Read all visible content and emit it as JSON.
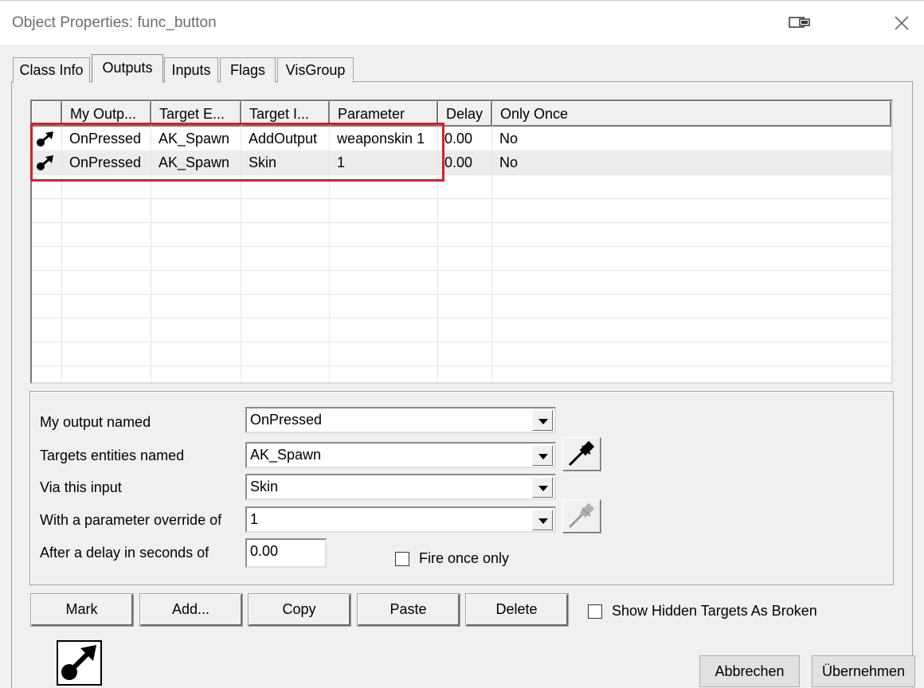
{
  "window": {
    "title": "Object Properties: func_button",
    "restore_icon": "restore-window-icon",
    "close_icon": "close-icon"
  },
  "tabs": [
    {
      "label": "Class Info",
      "active": false
    },
    {
      "label": "Outputs",
      "active": true
    },
    {
      "label": "Inputs",
      "active": false
    },
    {
      "label": "Flags",
      "active": false
    },
    {
      "label": "VisGroup",
      "active": false
    }
  ],
  "outputs_table": {
    "columns": [
      "",
      "My Outp...",
      "Target E...",
      "Target I...",
      "Parameter",
      "Delay",
      "Only Once"
    ],
    "rows": [
      {
        "icon": "output-connection-icon",
        "my_output": "OnPressed",
        "target_entity": "AK_Spawn",
        "target_input": "AddOutput",
        "parameter": "weaponskin 1",
        "delay": "0.00",
        "only_once": "No"
      },
      {
        "icon": "output-connection-icon",
        "my_output": "OnPressed",
        "target_entity": "AK_Spawn",
        "target_input": "Skin",
        "parameter": "1",
        "delay": "0.00",
        "only_once": "No"
      }
    ],
    "highlight_color": "#d4212a"
  },
  "editor": {
    "output_label": "My output named",
    "output_value": "OnPressed",
    "target_label": "Targets entities named",
    "target_value": "AK_Spawn",
    "input_label": "Via this input",
    "input_value": "Skin",
    "param_label": "With a parameter override of",
    "param_value": "1",
    "delay_label": "After a delay in seconds of",
    "delay_value": "0.00",
    "fire_once_label": "Fire once only",
    "fire_once_checked": false
  },
  "buttons": {
    "mark": "Mark",
    "add": "Add...",
    "copy": "Copy",
    "paste": "Paste",
    "delete": "Delete",
    "show_hidden_label": "Show Hidden Targets As Broken",
    "show_hidden_checked": false,
    "cancel": "Abbrechen",
    "apply": "Übernehmen"
  }
}
